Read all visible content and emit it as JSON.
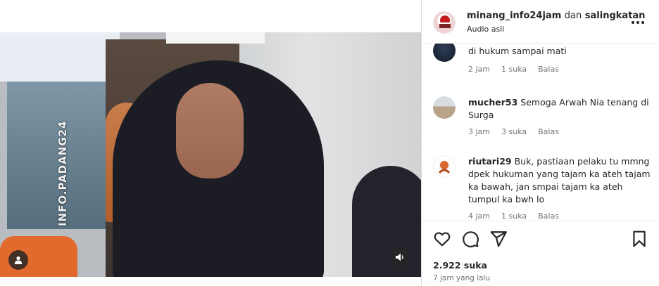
{
  "post": {
    "author": "minang_info24jam",
    "collab_connector": "dan",
    "collaborator": "salingkatan",
    "audio": "Audio asli",
    "video_watermark": "INFO.PADANG24"
  },
  "comments": [
    {
      "username": "",
      "text": "di hukum sampai mati",
      "time": "2 jam",
      "likes": "1 suka",
      "reply": "Balas"
    },
    {
      "username": "mucher53",
      "text": "Semoga Arwah Nia tenang di Surga",
      "time": "3 jam",
      "likes": "3 suka",
      "reply": "Balas"
    },
    {
      "username": "riutari29",
      "text": "Buk, pastiaan pelaku tu mmng dpek hukuman yang tajam ka ateh tajam ka bawah, jan smpai tajam ka ateh tumpul ka bwh lo",
      "time": "4 jam",
      "likes": "1 suka",
      "reply": "Balas"
    }
  ],
  "footer": {
    "likes": "2.922 suka",
    "time_ago": "7 jam yang lalu"
  },
  "icons": {
    "like": "heart-icon",
    "comment": "comment-icon",
    "share": "share-icon",
    "save": "bookmark-icon",
    "more": "more-icon",
    "user": "user-icon",
    "audio": "audio-icon"
  }
}
